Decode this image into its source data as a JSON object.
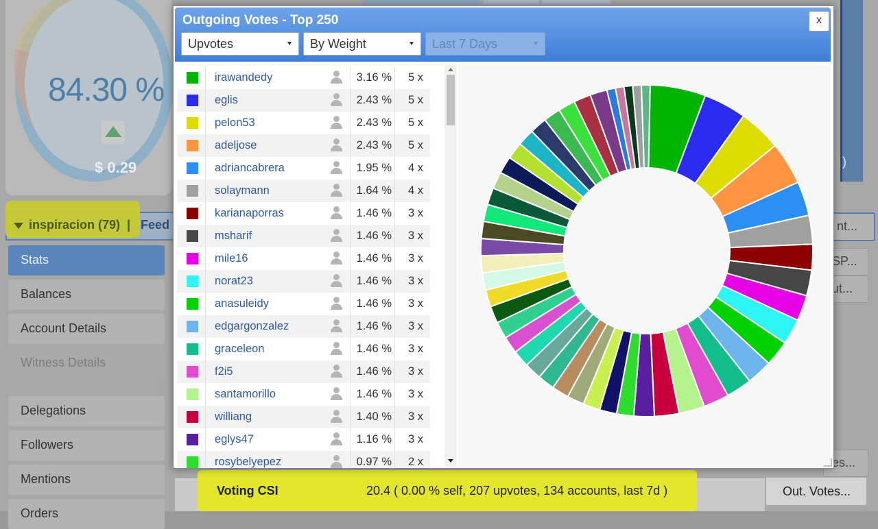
{
  "background": {
    "gauge": {
      "percent": "84.30 %",
      "value": "$ 0.29"
    },
    "right_tab_text": ")",
    "nav": {
      "account_title": "inspiracion (79)",
      "separator": "|",
      "feed_label": "Feed",
      "items": [
        {
          "label": "Stats",
          "state": "active"
        },
        {
          "label": "Balances",
          "state": "normal"
        },
        {
          "label": "Account Details",
          "state": "normal"
        },
        {
          "label": "Witness Details",
          "state": "disabled"
        },
        {
          "label": "Delegations",
          "state": "normal"
        },
        {
          "label": "Followers",
          "state": "normal"
        },
        {
          "label": "Mentions",
          "state": "normal"
        },
        {
          "label": "Orders",
          "state": "normal"
        }
      ]
    },
    "right_buttons": [
      "nt...",
      "SP...",
      "ut...",
      "es..."
    ],
    "csi": {
      "label": "Voting CSI",
      "value": "20.4 ( 0.00 % self, 207 upvotes, 134 accounts, last 7d )",
      "button": "Out. Votes..."
    }
  },
  "modal": {
    "title": "Outgoing Votes - Top 250",
    "close_label": "x",
    "filters": {
      "type": "Upvotes",
      "sort": "By Weight",
      "period": "Last 7 Days"
    },
    "rows": [
      {
        "name": "irawandedy",
        "pct": "3.16 %",
        "count": "5 x",
        "color": "#00b400"
      },
      {
        "name": "eglis",
        "pct": "2.43 %",
        "count": "5 x",
        "color": "#2b2bf0"
      },
      {
        "name": "pelon53",
        "pct": "2.43 %",
        "count": "5 x",
        "color": "#dcdc00"
      },
      {
        "name": "adeljose",
        "pct": "2.43 %",
        "count": "5 x",
        "color": "#ff9442"
      },
      {
        "name": "adriancabrera",
        "pct": "1.95 %",
        "count": "4 x",
        "color": "#2b8ef0"
      },
      {
        "name": "solaymann",
        "pct": "1.64 %",
        "count": "4 x",
        "color": "#a0a0a0"
      },
      {
        "name": "karianaporras",
        "pct": "1.46 %",
        "count": "3 x",
        "color": "#8c0000"
      },
      {
        "name": "msharif",
        "pct": "1.46 %",
        "count": "3 x",
        "color": "#464646"
      },
      {
        "name": "mile16",
        "pct": "1.46 %",
        "count": "3 x",
        "color": "#e600e6"
      },
      {
        "name": "norat23",
        "pct": "1.46 %",
        "count": "3 x",
        "color": "#2ef5f5"
      },
      {
        "name": "anasuleidy",
        "pct": "1.46 %",
        "count": "3 x",
        "color": "#00d200"
      },
      {
        "name": "edgargonzalez",
        "pct": "1.46 %",
        "count": "3 x",
        "color": "#6eb4ec"
      },
      {
        "name": "graceleon",
        "pct": "1.46 %",
        "count": "3 x",
        "color": "#14be8c"
      },
      {
        "name": "f2i5",
        "pct": "1.46 %",
        "count": "3 x",
        "color": "#e04bd0"
      },
      {
        "name": "santamorillo",
        "pct": "1.46 %",
        "count": "3 x",
        "color": "#b4f28c"
      },
      {
        "name": "williang",
        "pct": "1.40 %",
        "count": "3 x",
        "color": "#c8003c"
      },
      {
        "name": "eglys47",
        "pct": "1.16 %",
        "count": "3 x",
        "color": "#5a1ea0"
      },
      {
        "name": "rosybelyepez",
        "pct": "0.97 %",
        "count": "2 x",
        "color": "#2edc2e"
      }
    ],
    "chart_data": {
      "type": "pie",
      "style": "donut",
      "slices": [
        {
          "value": 3.16,
          "color": "#00b400"
        },
        {
          "value": 2.43,
          "color": "#2b2bf0"
        },
        {
          "value": 2.43,
          "color": "#dcdc00"
        },
        {
          "value": 2.43,
          "color": "#ff9442"
        },
        {
          "value": 1.95,
          "color": "#2b8ef0"
        },
        {
          "value": 1.64,
          "color": "#a0a0a0"
        },
        {
          "value": 1.46,
          "color": "#8c0000"
        },
        {
          "value": 1.46,
          "color": "#464646"
        },
        {
          "value": 1.46,
          "color": "#e600e6"
        },
        {
          "value": 1.46,
          "color": "#2ef5f5"
        },
        {
          "value": 1.46,
          "color": "#00d200"
        },
        {
          "value": 1.46,
          "color": "#6eb4ec"
        },
        {
          "value": 1.46,
          "color": "#14be8c"
        },
        {
          "value": 1.46,
          "color": "#e04bd0"
        },
        {
          "value": 1.46,
          "color": "#b4f28c"
        },
        {
          "value": 1.4,
          "color": "#c8003c"
        },
        {
          "value": 1.16,
          "color": "#5a1ea0"
        },
        {
          "value": 0.97,
          "color": "#2edc2e"
        },
        {
          "value": 0.97,
          "color": "#121268"
        },
        {
          "value": 0.97,
          "color": "#c8f050"
        },
        {
          "value": 0.97,
          "color": "#a0aa78"
        },
        {
          "value": 0.97,
          "color": "#b88c5c"
        },
        {
          "value": 0.97,
          "color": "#30b890"
        },
        {
          "value": 0.97,
          "color": "#68a898"
        },
        {
          "value": 0.97,
          "color": "#20d8b0"
        },
        {
          "value": 0.97,
          "color": "#d850d0"
        },
        {
          "value": 0.97,
          "color": "#30d090"
        },
        {
          "value": 0.97,
          "color": "#0a5a14"
        },
        {
          "value": 0.97,
          "color": "#f0dc28"
        },
        {
          "value": 0.97,
          "color": "#d2f8e6"
        },
        {
          "value": 0.97,
          "color": "#f2f0b8"
        },
        {
          "value": 0.97,
          "color": "#7a4aa8"
        },
        {
          "value": 0.97,
          "color": "#4a4a22"
        },
        {
          "value": 0.97,
          "color": "#12e87a"
        },
        {
          "value": 0.97,
          "color": "#0a5a3a"
        },
        {
          "value": 0.97,
          "color": "#b4d28c"
        },
        {
          "value": 0.97,
          "color": "#0a1a5a"
        },
        {
          "value": 0.97,
          "color": "#b4e030"
        },
        {
          "value": 0.97,
          "color": "#1eb4c8"
        },
        {
          "value": 0.97,
          "color": "#2a3a6a"
        },
        {
          "value": 0.97,
          "color": "#3cb850"
        },
        {
          "value": 0.97,
          "color": "#3ce03c"
        },
        {
          "value": 0.97,
          "color": "#a83040"
        },
        {
          "value": 0.97,
          "color": "#7a3a8a"
        },
        {
          "value": 0.49,
          "color": "#2a7ae0"
        },
        {
          "value": 0.49,
          "color": "#c878a0"
        },
        {
          "value": 0.49,
          "color": "#0a3a1a"
        },
        {
          "value": 0.49,
          "color": "#9aa0a0"
        },
        {
          "value": 0.49,
          "color": "#5ab880"
        }
      ]
    }
  }
}
